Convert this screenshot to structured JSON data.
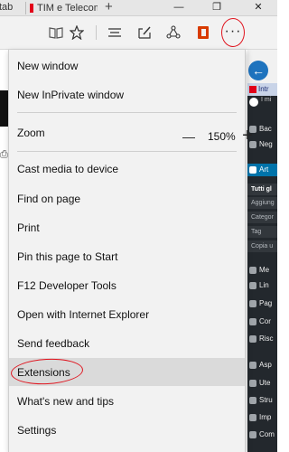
{
  "tabs": {
    "left_tab_fragment": "tab",
    "active_tab_title": "TIM e Telecom",
    "new_tab_symbol": "+"
  },
  "window_controls": {
    "minimize": "—",
    "restore": "❐",
    "close": "✕"
  },
  "toolbar": {
    "reading_view_icon": "book-icon",
    "favorite_icon": "star-icon",
    "hub_icon": "hub-lines-icon",
    "notes_icon": "pen-note-icon",
    "share_icon": "share-icon",
    "office_icon": "office-icon",
    "more_label": "···"
  },
  "menu": {
    "items": [
      {
        "label": "New window"
      },
      {
        "label": "New InPrivate window"
      },
      {
        "label": "Zoom"
      },
      {
        "label": "Cast media to device"
      },
      {
        "label": "Find on page"
      },
      {
        "label": "Print"
      },
      {
        "label": "Pin this page to Start"
      },
      {
        "label": "F12 Developer Tools"
      },
      {
        "label": "Open with Internet Explorer"
      },
      {
        "label": "Send feedback"
      },
      {
        "label": "Extensions"
      },
      {
        "label": "What's new and tips"
      },
      {
        "label": "Settings"
      }
    ],
    "zoom_value": "150%",
    "zoom_minus": "—",
    "zoom_plus": "+"
  },
  "background_sidebar": {
    "back_arrow": "←",
    "site_title": "Intr",
    "site_sub": "I mi",
    "items": [
      {
        "label": "Bac"
      },
      {
        "label": "Neg"
      },
      {
        "label": "Art"
      },
      {
        "label": "Tutti gl"
      },
      {
        "label": "Aggiung"
      },
      {
        "label": "Categor"
      },
      {
        "label": "Tag"
      },
      {
        "label": "Copia u"
      },
      {
        "label": "Me"
      },
      {
        "label": "Lin"
      },
      {
        "label": "Pag"
      },
      {
        "label": "Cor"
      },
      {
        "label": "Risc"
      },
      {
        "label": "Asp"
      },
      {
        "label": "Ute"
      },
      {
        "label": "Stru"
      },
      {
        "label": "Imp"
      },
      {
        "label": "Com"
      }
    ]
  },
  "colors": {
    "annotation_red": "#e0141e",
    "wp_active": "#0073aa",
    "wp_dark": "#23282d",
    "tim_red": "#e2001a"
  }
}
